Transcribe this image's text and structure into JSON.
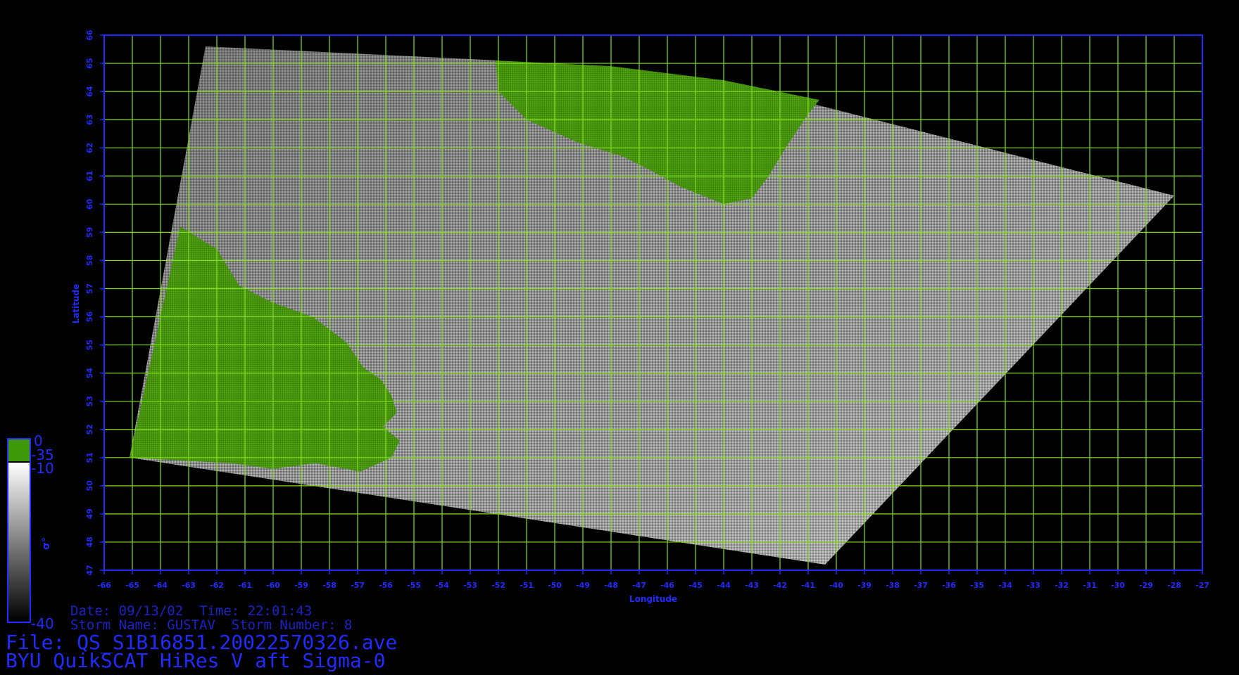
{
  "map": {
    "xaxis": {
      "label": "Longitude",
      "ticks": [
        "-66",
        "-65",
        "-64",
        "-63",
        "-62",
        "-61",
        "-60",
        "-59",
        "-58",
        "-57",
        "-56",
        "-55",
        "-54",
        "-53",
        "-52",
        "-51",
        "-50",
        "-49",
        "-48",
        "-47",
        "-46",
        "-45",
        "-44",
        "-43",
        "-42",
        "-41",
        "-40",
        "-39",
        "-38",
        "-37",
        "-36",
        "-35",
        "-34",
        "-33",
        "-32",
        "-31",
        "-30",
        "-29",
        "-28",
        "-27"
      ],
      "range": [
        -66,
        -27
      ]
    },
    "yaxis": {
      "label": "Latitude",
      "ticks": [
        "47",
        "48",
        "49",
        "50",
        "51",
        "52",
        "53",
        "54",
        "55",
        "56",
        "57",
        "58",
        "59",
        "60",
        "61",
        "62",
        "63",
        "64",
        "65",
        "66"
      ],
      "range": [
        47,
        66
      ]
    },
    "grid": true,
    "colors": {
      "background": "#000000",
      "grid": "#7fe01a",
      "axis": "#1f2bff",
      "land": "#4f9a10",
      "ocean_light": "#d4d4d4",
      "ocean_dark": "#5e5e5e"
    },
    "swath_outline": [
      [
        -62.4,
        65.6
      ],
      [
        -52,
        65.1
      ],
      [
        -41,
        63.6
      ],
      [
        -28,
        60.3
      ],
      [
        -40.4,
        47.2
      ],
      [
        -65.1,
        51.0
      ]
    ],
    "land_regions": [
      {
        "name": "labrador",
        "polygon": [
          [
            -63.3,
            59.2
          ],
          [
            -62,
            58.4
          ],
          [
            -61.2,
            57.1
          ],
          [
            -60,
            56.5
          ],
          [
            -58.6,
            56.0
          ],
          [
            -57.4,
            55.1
          ],
          [
            -56.8,
            54.2
          ],
          [
            -56.2,
            53.8
          ],
          [
            -55.8,
            53.2
          ],
          [
            -55.6,
            52.6
          ],
          [
            -56.1,
            52.1
          ],
          [
            -55.5,
            51.6
          ],
          [
            -55.8,
            51.0
          ],
          [
            -56.9,
            50.5
          ],
          [
            -58.5,
            50.8
          ],
          [
            -60.0,
            50.6
          ],
          [
            -61.5,
            50.8
          ],
          [
            -65.1,
            51.0
          ]
        ]
      },
      {
        "name": "greenland",
        "polygon": [
          [
            -52.1,
            65.1
          ],
          [
            -52.0,
            64.0
          ],
          [
            -51.0,
            63.0
          ],
          [
            -49.2,
            62.2
          ],
          [
            -47.6,
            61.7
          ],
          [
            -46.6,
            61.2
          ],
          [
            -45.5,
            60.6
          ],
          [
            -44.0,
            60.0
          ],
          [
            -43.0,
            60.2
          ],
          [
            -42.4,
            61.0
          ],
          [
            -41.8,
            62.0
          ],
          [
            -41.0,
            63.2
          ],
          [
            -40.6,
            63.7
          ],
          [
            -44.0,
            64.4
          ],
          [
            -48.0,
            64.9
          ]
        ]
      }
    ],
    "legend": {
      "label_top": "0",
      "label_land": "-35",
      "label_upper": "-10",
      "label_bottom": "-40",
      "units": "σ°",
      "land_color": "#3f9a0a",
      "gradient_top": "#ffffff",
      "gradient_bottom": "#000000"
    }
  },
  "info": {
    "date_line": "Date: 09/13/02  Time: 22:01:43",
    "storm_line": "Storm Name: GUSTAV  Storm Number: 8",
    "file_line": "File: QS_S1B16851.20022570326.ave",
    "title_line": "BYU QuikSCAT HiRes V aft Sigma-0"
  }
}
